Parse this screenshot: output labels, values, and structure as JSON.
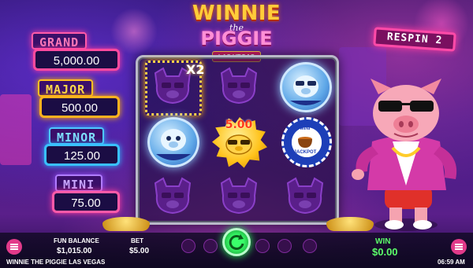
{
  "logo": {
    "line1": "WINNIE",
    "line2": "the",
    "line3": "PIGGIE",
    "badge": "LAS VEGAS"
  },
  "jackpots": [
    {
      "name": "GRAND",
      "value": "5,000.00",
      "color": "#ff4a9e"
    },
    {
      "name": "MAJOR",
      "value": "500.00",
      "color": "#ffb21e"
    },
    {
      "name": "MINOR",
      "value": "125.00",
      "color": "#39c0ff"
    },
    {
      "name": "MINI",
      "value": "75.00",
      "color": "#b07cff"
    }
  ],
  "respin": {
    "label": "RESPIN",
    "count": "2"
  },
  "reels": {
    "multiplier": "X2",
    "gold_coin_value": "5.00",
    "chip_line1": "MINI",
    "chip_line2": "JACKPOT",
    "icons": [
      "pig-ghost-icon",
      "blue-pig-coin-icon",
      "gold-coin-icon",
      "mini-jackpot-chip-icon"
    ]
  },
  "bottom_bar": {
    "fun_balance_label": "FUN BALANCE",
    "fun_balance_value": "$1,015.00",
    "bet_label": "BET",
    "bet_value": "$5.00",
    "win_label": "WIN",
    "win_value": "$0.00",
    "game_title": "WINNIE THE PIGGIE LAS VEGAS",
    "clock": "06:59 AM"
  }
}
